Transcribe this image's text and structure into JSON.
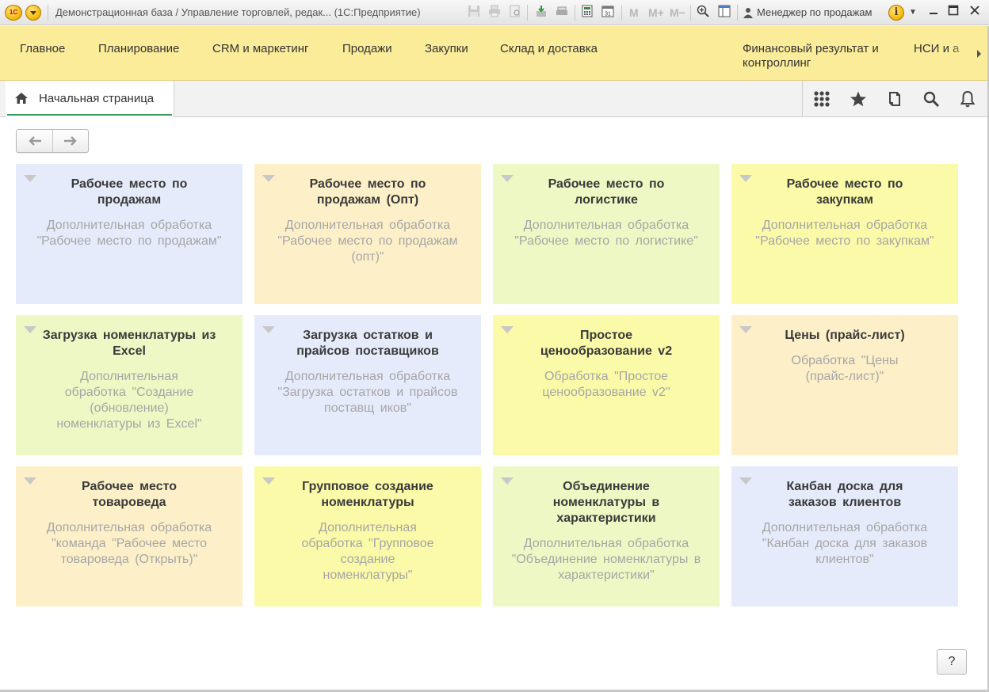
{
  "window": {
    "title": "Демонстрационная база / Управление торговлей, редак...  (1С:Предприятие)",
    "user": "Менеджер по продажам",
    "logo_text": "1С"
  },
  "sections": [
    {
      "label": "Главное"
    },
    {
      "label": "Планирование"
    },
    {
      "label": "CRM и маркетинг"
    },
    {
      "label": "Продажи"
    },
    {
      "label": "Закупки"
    },
    {
      "label": "Склад и доставка"
    },
    {
      "label": "Финансовый результат и контроллинг"
    },
    {
      "label": "НСИ и а"
    }
  ],
  "tabs": {
    "home_label": "Начальная страница"
  },
  "tiles": [
    {
      "title": "Рабочее место по продажам",
      "desc": "Дополнительная обработка \"Рабочее место по продажам\"",
      "color": "#e6ebfb"
    },
    {
      "title": "Рабочее место по продажам (Опт)",
      "desc": "Дополнительная обработка \"Рабочее место по продажам (опт)\"",
      "color": "#fdf0c8"
    },
    {
      "title": "Рабочее место по логистике",
      "desc": "Дополнительная обработка \"Рабочее место по логистике\"",
      "color": "#edf8c4"
    },
    {
      "title": "Рабочее место по закупкам",
      "desc": "Дополнительная обработка \"Рабочее место по закупкам\"",
      "color": "#fafaa8"
    },
    {
      "title": "Загрузка номенклатуры из Excel",
      "desc": "Дополнительная обработка \"Создание (обновление) номенклатуры из Excel\"",
      "color": "#edf8c4"
    },
    {
      "title": "Загрузка остатков и прайсов поставщиков",
      "desc": "Дополнительная обработка \"Загрузка остатков и прайсов поставщ иков\"",
      "color": "#e6ebfb"
    },
    {
      "title": "Простое ценообразование v2",
      "desc": "Обработка \"Простое ценообразование v2\"",
      "color": "#fafaa8"
    },
    {
      "title": "Цены (прайс-лист)",
      "desc": "Обработка \"Цены (прайс-лист)\"",
      "color": "#fdf0c8"
    },
    {
      "title": "Рабочее место товароведа",
      "desc": "Дополнительная обработка \"команда \"Рабочее место товароведа (Открыть)\"",
      "color": "#fdf0c8"
    },
    {
      "title": "Групповое создание номенклатуры",
      "desc": "Дополнительная обработка \"Групповое создание номенклатуры\"",
      "color": "#fafaa8"
    },
    {
      "title": "Объединение номенклатуры в характеристики",
      "desc": "Дополнительная обработка \"Объединение номенклатуры в характеристики\"",
      "color": "#edf8c4"
    },
    {
      "title": "Канбан доска для заказов клиентов",
      "desc": "Дополнительная обработка \"Канбан доска для заказов клиентов\"",
      "color": "#e6ebfb"
    }
  ],
  "help": {
    "label": "?"
  },
  "toolbar_m": {
    "m": "M",
    "m_plus": "M+",
    "m_minus": "M−"
  }
}
